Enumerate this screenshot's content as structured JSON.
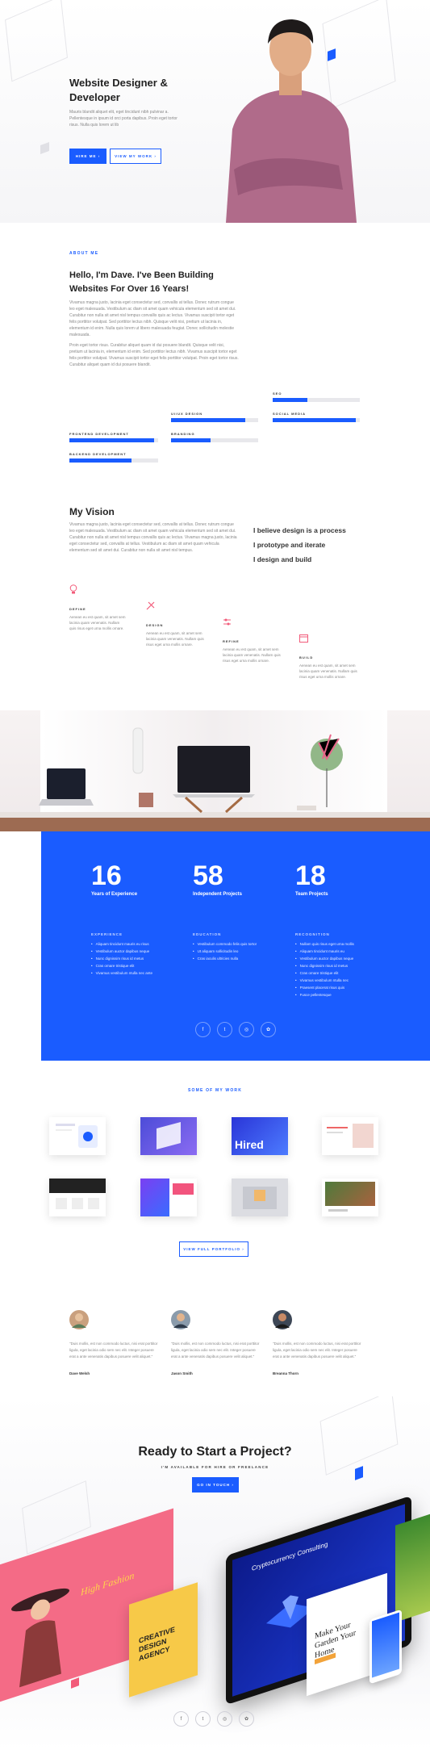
{
  "hero": {
    "title": "Website Designer & Developer",
    "description": "Mauris blandit aliquet elit, eget tincidunt nibh pulvinar a. Pellentesque in ipsum id orci porta dapibus. Proin eget tortor risus. Nulla quis lorem ut lib",
    "hire_button": "HIRE ME ›",
    "work_button": "VIEW MY WORK ›"
  },
  "about": {
    "label": "ABOUT ME",
    "heading": "Hello, I'm Dave. I've Been Building Websites For Over 16 Years!",
    "para1": "Vivamus magna justo, lacinia eget consectetur sed, convallis at tellus. Donec rutrum congue leo eget malesuada. Vestibulum ac diam sit amet quam vehicula elementum sed sit amet dui. Curabitur non nulla sit amet nisl tempus convallis quis ac lectus. Vivamus suscipit tortor eget felis porttitor volutpat. Sed porttitor lectus nibh. Quisque velit nisi, pretium ut lacinia in, elementum id enim. Nulla quis lorem ut libero malesuada feugiat. Donec sollicitudin molestie malesuada.",
    "para2": "Proin eget tortor risus. Curabitur aliquet quam id dui posuere blandit. Quisque velit nisi, pretium ut lacinia in, elementum id enim. Sed porttitor lectus nibh. Vivamus suscipit tortor eget felis porttitor volutpat. Vivamus suscipit tortor eget felis porttitor volutpat. Proin eget tortor risus. Curabitur aliquet quam id dui posuere blandit."
  },
  "skills": [
    {
      "name": "FRONTEND DEVELOPMENT",
      "level": 0.95
    },
    {
      "name": "BACKEND DEVELOPMENT",
      "level": 0.7
    },
    {
      "name": "UI/UX DESIGN",
      "level": 0.85
    },
    {
      "name": "BRANDING",
      "level": 0.45
    },
    {
      "name": "SEO",
      "level": 0.4
    },
    {
      "name": "SOCIAL MEDIA",
      "level": 0.95
    }
  ],
  "vision": {
    "heading": "My Vision",
    "para": "Vivamus magna justo, lacinia eget consectetur sed, convallis at tellus. Donec rutrum congue leo eget malesuada. Vestibulum ac diam sit amet quam vehicula elementum sed sit amet dui. Curabitur non nulla sit amet nisl tempus convallis quis ac lectus. Vivamus magna justo, lacinia eget consectetur sed, convallis at tellus. Vestibulum ac diam sit amet quam vehicula elementum sed sit amet dui. Curabitur non nulla sit amet nisl tempus.",
    "line1": "I believe design is a process",
    "line2": "I prototype and iterate",
    "line3": "I design and build"
  },
  "process": [
    {
      "title": "DEFINE",
      "text": "Aenean eu est quam, sit amet sem lacinia quam venenatis. Nullam quis risus eget urna mollis ornare."
    },
    {
      "title": "DESIGN",
      "text": "Aenean eu est quam, sit amet sem lacinia quam venenatis. Nullam quis risus eget urna mollis ornare."
    },
    {
      "title": "REFINE",
      "text": "Aenean eu est quam, sit amet sem lacinia quam venenatis. Nullam quis risus eget urna mollis ornare."
    },
    {
      "title": "BUILD",
      "text": "Aenean eu est quam, sit amet sem lacinia quam venenatis. Nullam quis risus eget urna mollis ornare."
    }
  ],
  "stats": [
    {
      "num": "16",
      "label": "Years of Experience"
    },
    {
      "num": "58",
      "label": "Independent Projects"
    },
    {
      "num": "18",
      "label": "Team Projects"
    }
  ],
  "lists": [
    {
      "head": "EXPERIENCE",
      "items": [
        "Aliquam tincidunt mauris eu risus",
        "Vestibulum auctor dapibus neque",
        "Nunc dignissim risus id metus",
        "Cras ornare tristique elit",
        "Vivamus vestibulum ntulla nec ante"
      ]
    },
    {
      "head": "EDUCATION",
      "items": [
        "Vestibulum commodo felis quis tortor",
        "Ut aliquam sollicitudin leo",
        "Cras iaculis ultricies nulla"
      ]
    },
    {
      "head": "RECOGNITION",
      "items": [
        "Nullam quis risus eget urna mollis",
        "Aliquam tincidunt mauris eu",
        "Vestibulum auctor dapibus neque",
        "Nunc dignissim risus id metus",
        "Cras ornare tristique elit",
        "Vivamus vestibulum ntulla nec",
        "Praesent placerat risus quis",
        "Fusce pellentesque"
      ]
    }
  ],
  "work": {
    "label": "SOME OF MY WORK",
    "button": "VIEW FULL PORTFOLIO ›",
    "thumb_hired": "Hired"
  },
  "testimonials": [
    {
      "quote": "\"Duis mollis, est non commodo luctus, nisi erat porttitor ligula, eget lacinia odio sem nec elit. Integer posuere erat a ante venenatis dapibus posuere velit aliquet.\"",
      "name": "Dave Welsh"
    },
    {
      "quote": "\"Duis mollis, est non commodo luctus, nisi erat porttitor ligula, eget lacinia odio sem nec elit. Integer posuere erat a ante venenatis dapibus posuere velit aliquet.\"",
      "name": "Jason Smith"
    },
    {
      "quote": "\"Duis mollis, est non commodo luctus, nisi erat porttitor ligula, eget lacinia odio sem nec elit. Integer posuere erat a ante venenatis dapibus posuere velit aliquet.\"",
      "name": "Breanna Thorn"
    }
  ],
  "cta": {
    "heading": "Ready to Start a Project?",
    "sub": "I'M AVAILABLE FOR HIRE OR FREELANCE",
    "button": "GO IN TOUCH ›",
    "mock_fashion": "High Fashion",
    "mock_agency": "CREATIVE DESIGN AGENCY",
    "mock_crypto": "Cryptocurrency Consulting",
    "mock_garden": "Make Your Garden Your Home"
  },
  "social_icons": [
    "f",
    "t",
    "◎",
    "✿"
  ],
  "colors": {
    "accent": "#1a5cff",
    "pink": "#f25b7a",
    "yellow": "#f7c948"
  }
}
